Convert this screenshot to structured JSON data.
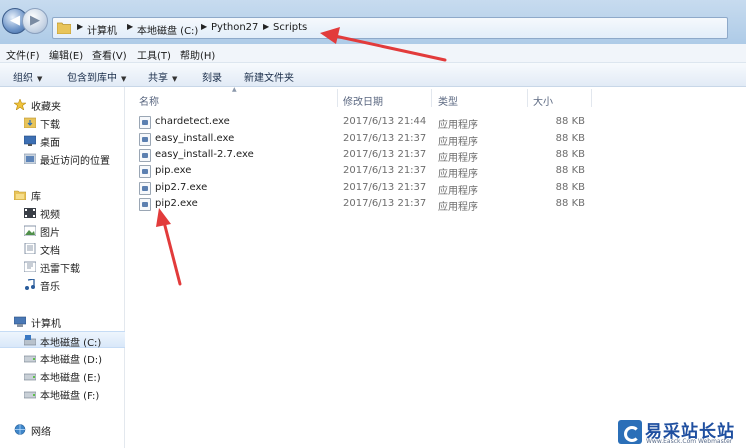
{
  "address_bar": {
    "breadcrumbs": [
      "计算机",
      "本地磁盘 (C:)",
      "Python27",
      "Scripts"
    ]
  },
  "menu": [
    "文件(F)",
    "编辑(E)",
    "查看(V)",
    "工具(T)",
    "帮助(H)"
  ],
  "toolbar": {
    "organize": "组织",
    "include_in_library": "包含到库中",
    "share": "共享",
    "burn": "刻录",
    "new_folder": "新建文件夹"
  },
  "sidebar": {
    "favorites": {
      "label": "收藏夹",
      "items": [
        "下载",
        "桌面",
        "最近访问的位置"
      ]
    },
    "libraries": {
      "label": "库",
      "items": [
        "视频",
        "图片",
        "文档",
        "迅雷下载",
        "音乐"
      ]
    },
    "computer": {
      "label": "计算机",
      "items": [
        "本地磁盘 (C:)",
        "本地磁盘 (D:)",
        "本地磁盘 (E:)",
        "本地磁盘 (F:)"
      ]
    },
    "network": {
      "label": "网络"
    }
  },
  "columns": {
    "name": "名称",
    "modified": "修改日期",
    "type": "类型",
    "size": "大小"
  },
  "files": [
    {
      "name": "chardetect.exe",
      "modified": "2017/6/13 21:44",
      "type": "应用程序",
      "size": "88 KB"
    },
    {
      "name": "easy_install.exe",
      "modified": "2017/6/13 21:37",
      "type": "应用程序",
      "size": "88 KB"
    },
    {
      "name": "easy_install-2.7.exe",
      "modified": "2017/6/13 21:37",
      "type": "应用程序",
      "size": "88 KB"
    },
    {
      "name": "pip.exe",
      "modified": "2017/6/13 21:37",
      "type": "应用程序",
      "size": "88 KB"
    },
    {
      "name": "pip2.7.exe",
      "modified": "2017/6/13 21:37",
      "type": "应用程序",
      "size": "88 KB"
    },
    {
      "name": "pip2.exe",
      "modified": "2017/6/13 21:37",
      "type": "应用程序",
      "size": "88 KB"
    }
  ],
  "watermark": {
    "title": "易采站长站",
    "subtitle": "Www.Easck.Com Webmaster"
  },
  "colors": {
    "annotation_arrow": "#e23b3b",
    "selected_drive": "#d9e8f9",
    "address_bar": "#aecbe7"
  }
}
